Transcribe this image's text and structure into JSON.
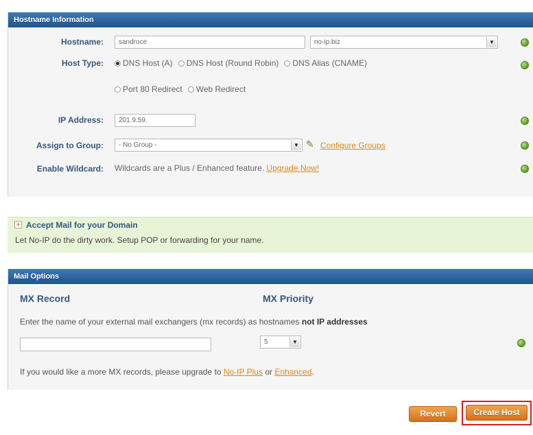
{
  "hostname_section": {
    "title": "Hostname Information",
    "hostname_label": "Hostname:",
    "hostname_value": "sandroce",
    "domain_value": "no-ip.biz",
    "host_type_label": "Host Type:",
    "host_types": [
      "DNS Host (A)",
      "DNS Host (Round Robin)",
      "DNS Alias (CNAME)",
      "Port 80 Redirect",
      "Web Redirect"
    ],
    "ip_label": "IP Address:",
    "ip_value": "201.9.59.",
    "group_label": "Assign to Group:",
    "group_value": "- No Group -",
    "configure_groups": "Configure Groups",
    "wildcard_label": "Enable Wildcard:",
    "wildcard_text": "Wildcards are a Plus / Enhanced feature.",
    "upgrade_now": "Upgrade Now!"
  },
  "mail_promo": {
    "toggle": "+",
    "title": "Accept Mail for your Domain",
    "text": "Let No-IP do the dirty work. Setup POP or forwarding for your name."
  },
  "mail_options": {
    "title": "Mail Options",
    "mx_record_heading": "MX Record",
    "mx_priority_heading": "MX Priority",
    "instruction_prefix": "Enter the name of your external mail exchangers (mx records) as hostnames",
    "instruction_bold": "not IP addresses",
    "mx_value": "",
    "priority_value": "5",
    "upgrade_prefix": "If you would like a more MX records, please upgrade to",
    "plus_link": "No-IP Plus",
    "or_text": "or",
    "enhanced_link": "Enhanced",
    "period": "."
  },
  "actions": {
    "revert": "Revert",
    "create_host": "Create Host"
  },
  "colors": {
    "header_blue": "#2a63a0",
    "label_blue": "#35577f",
    "accent_orange": "#e07f22",
    "promo_green": "#e8f4d8",
    "ok_green": "#5a9a1c",
    "highlight_red": "#d21f1f"
  }
}
